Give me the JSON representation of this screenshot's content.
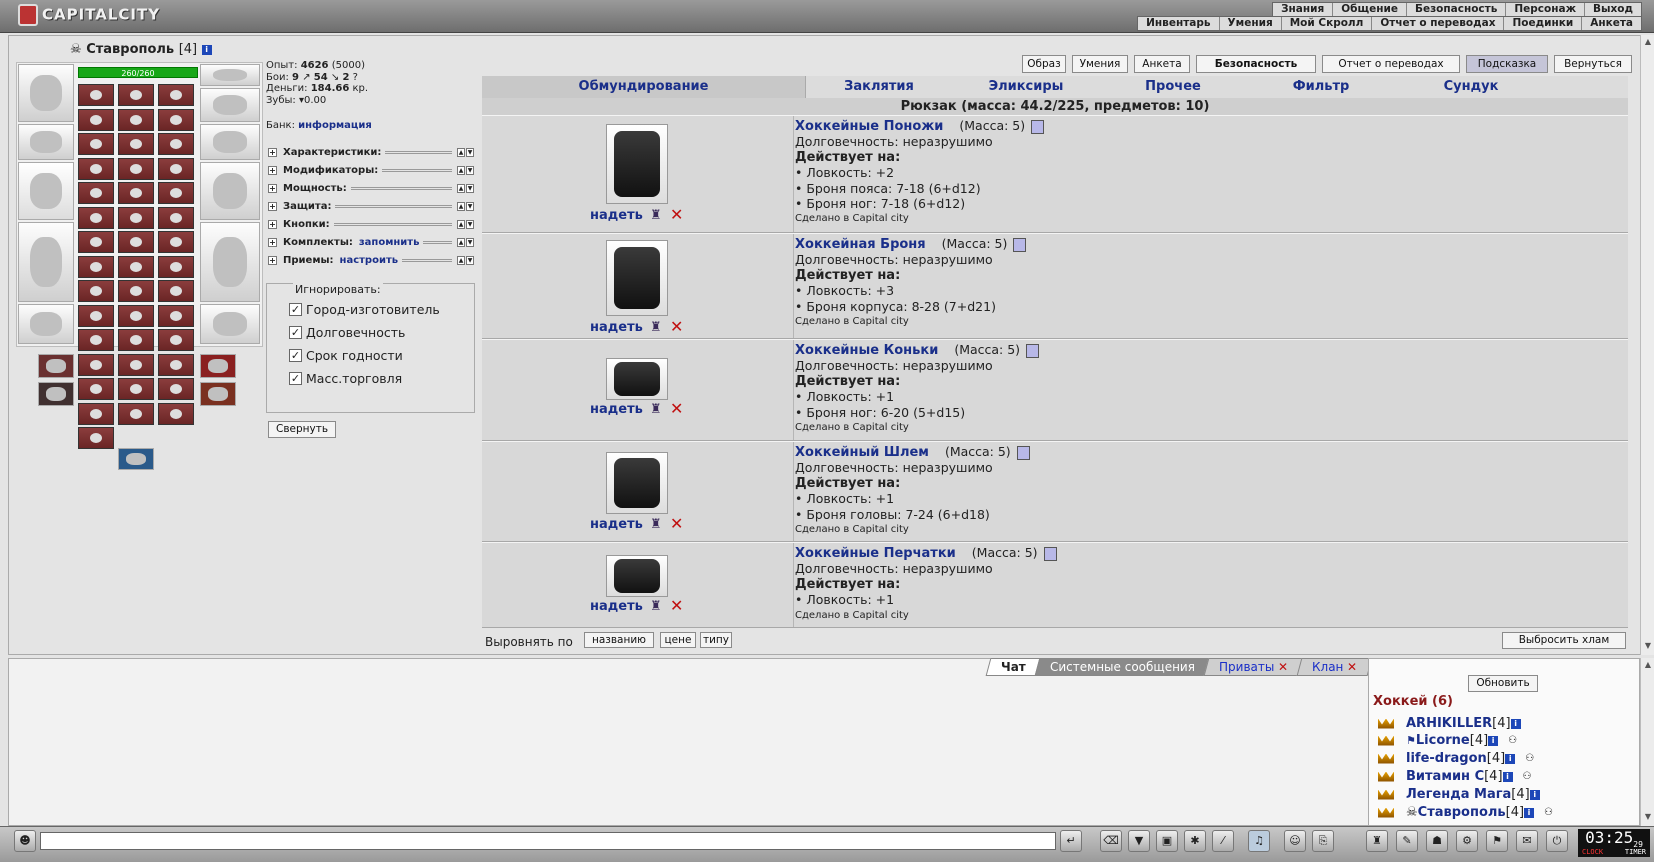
{
  "app": {
    "logo": "CAPITALCITY"
  },
  "topmenu": {
    "row1": [
      "Знания",
      "Общение",
      "Безопасность",
      "Персонаж",
      "Выход"
    ],
    "row2": [
      "Инвентарь",
      "Умения",
      "Мой Скролл",
      "Отчет о переводах",
      "Поединки",
      "Анкета"
    ]
  },
  "character": {
    "name": "Ставрополь",
    "level": "[4]",
    "hp": "260/260",
    "exp_label": "Опыт:",
    "exp": "4626",
    "exp_next": "(5000)",
    "fights_label": "Бои:",
    "wins": "9",
    "losses": "54",
    "draws": "2",
    "money_label": "Деньги:",
    "money": "184.66",
    "money_unit": "кр.",
    "teeth_label": "Зубы:",
    "teeth": "0.00",
    "bank_label": "Банк:",
    "bank_link": "информация"
  },
  "sections": [
    {
      "label": "Характеристики:",
      "link": ""
    },
    {
      "label": "Модификаторы:",
      "link": ""
    },
    {
      "label": "Мощность:",
      "link": ""
    },
    {
      "label": "Защита:",
      "link": ""
    },
    {
      "label": "Кнопки:",
      "link": ""
    },
    {
      "label": "Комплекты:",
      "link": "запомнить"
    },
    {
      "label": "Приемы:",
      "link": "настроить"
    }
  ],
  "ignore": {
    "legend": "Игнорировать:",
    "options": [
      "Город-изготовитель",
      "Долговечность",
      "Срок годности",
      "Масс.торговля"
    ],
    "collapse": "Свернуть"
  },
  "topbuttons": [
    "Образ",
    "Умения",
    "Анкета",
    "Безопасность",
    "Отчет о переводах",
    "Подсказка",
    "Вернуться"
  ],
  "tabs": [
    "Обмундирование",
    "Заклятия",
    "Эликсиры",
    "Прочее",
    "Фильтр",
    "Сундук"
  ],
  "bag_title": "Рюкзак (масса: 44.2/225, предметов: 10)",
  "wear_label": "надеть",
  "items": [
    {
      "name": "Хоккейные Поножи",
      "mass": "(Масса: 5)",
      "durability": "Долговечность: неразрушимо",
      "effects_title": "Действует на:",
      "effects": [
        "• Ловкость: +2",
        "• Броня пояса: 7-18 (6+d12)",
        "• Броня ног: 7-18 (6+d12)"
      ],
      "made": "Сделано в Capital city"
    },
    {
      "name": "Хоккейная Броня",
      "mass": "(Масса: 5)",
      "durability": "Долговечность: неразрушимо",
      "effects_title": "Действует на:",
      "effects": [
        "• Ловкость: +3",
        "• Броня корпуса: 8-28 (7+d21)"
      ],
      "made": "Сделано в Capital city"
    },
    {
      "name": "Хоккейные Коньки",
      "mass": "(Масса: 5)",
      "durability": "Долговечность: неразрушимо",
      "effects_title": "Действует на:",
      "effects": [
        "• Ловкость: +1",
        "• Броня ног: 6-20 (5+d15)"
      ],
      "made": "Сделано в Capital city"
    },
    {
      "name": "Хоккейный Шлем",
      "mass": "(Масса: 5)",
      "durability": "Долговечность: неразрушимо",
      "effects_title": "Действует на:",
      "effects": [
        "• Ловкость: +1",
        "• Броня головы: 7-24 (6+d18)"
      ],
      "made": "Сделано в Capital city"
    },
    {
      "name": "Хоккейные Перчатки",
      "mass": "(Масса: 5)",
      "durability": "Долговечность: неразрушимо",
      "effects_title": "Действует на:",
      "effects": [
        "• Ловкость: +1"
      ],
      "made": "Сделано в Capital city"
    }
  ],
  "sort": {
    "label": "Выровнять по",
    "options": [
      "названию",
      "цене",
      "типу"
    ],
    "throw": "Выбросить хлам"
  },
  "chat": {
    "tabs": [
      "Чат",
      "Системные сообщения",
      "Приваты",
      "Клан"
    ]
  },
  "online": {
    "refresh": "Обновить",
    "clan": "Хоккей (6)",
    "users": [
      {
        "name": "ARHIKILLER",
        "level": "[4]"
      },
      {
        "name": "Licorne",
        "level": "[4]"
      },
      {
        "name": "life-dragon",
        "level": "[4]"
      },
      {
        "name": "Витамин С",
        "level": "[4]"
      },
      {
        "name": "Легенда Мага",
        "level": "[4]"
      },
      {
        "name": "Ставрополь",
        "level": "[4]"
      }
    ]
  },
  "clock": {
    "time": "03:25",
    "sec": "29",
    "clock_label": "CLOCK",
    "timer_label": "TIMER"
  },
  "colors": {
    "link": "#1a2f8a",
    "delete": "#c01010",
    "hp": "#17a717",
    "clan": "#8a1a1a"
  }
}
